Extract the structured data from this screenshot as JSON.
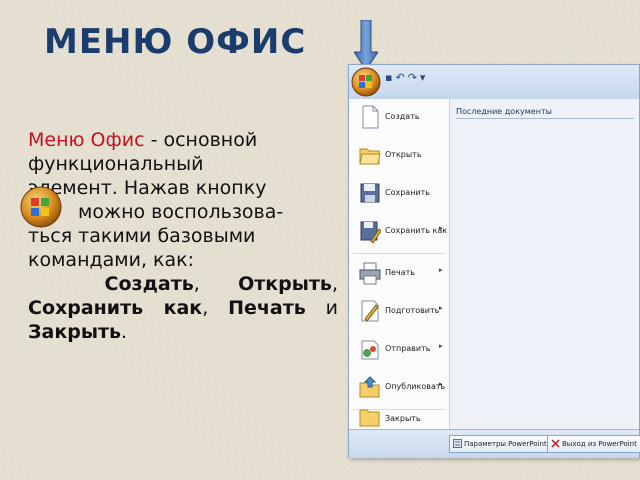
{
  "slide": {
    "title": "МЕНЮ ОФИС",
    "p1_red": "Меню Офис",
    "p1_line1_rest": " - основной",
    "p1_line2": "функциональный",
    "p1_line3": "элемент. Нажав кнопку",
    "p1_line4": "можно воспользова-",
    "p1_line5": "ться такими базовыми",
    "p1_line6": "командами, как:",
    "p2_create": "Создать",
    "p2_comma1": ", ",
    "p2_open": "Открыть",
    "p2_comma2": ",",
    "p2_save_as": "Сохранить как",
    "p2_comma3": ",",
    "p2_print": "Печать",
    "p2_and": " и ",
    "p2_close": "Закрыть",
    "p2_end": "."
  },
  "menu": {
    "recent_title": "Последние документы",
    "items": [
      {
        "label": "Создать",
        "icon": "new-document-icon",
        "has_arrow": false
      },
      {
        "label": "Открыть",
        "icon": "open-folder-icon",
        "has_arrow": false
      },
      {
        "label": "Сохранить",
        "icon": "save-floppy-icon",
        "has_arrow": false
      },
      {
        "label": "Сохранить как",
        "icon": "save-as-icon",
        "has_arrow": true
      },
      {
        "label": "Печать",
        "icon": "printer-icon",
        "has_arrow": true
      },
      {
        "label": "Подготовить",
        "icon": "prepare-icon",
        "has_arrow": true
      },
      {
        "label": "Отправить",
        "icon": "send-icon",
        "has_arrow": true
      },
      {
        "label": "Опубликовать",
        "icon": "publish-icon",
        "has_arrow": true
      },
      {
        "label": "Закрыть",
        "icon": "close-folder-icon",
        "has_arrow": false
      }
    ],
    "bottom": {
      "options_label": "Параметры PowerPoint",
      "exit_label": "Выход из PowerPoint"
    }
  },
  "colors": {
    "title": "#1b3d6d",
    "accent_red": "#c1121f",
    "arrow_blue": "#4a78b8"
  }
}
